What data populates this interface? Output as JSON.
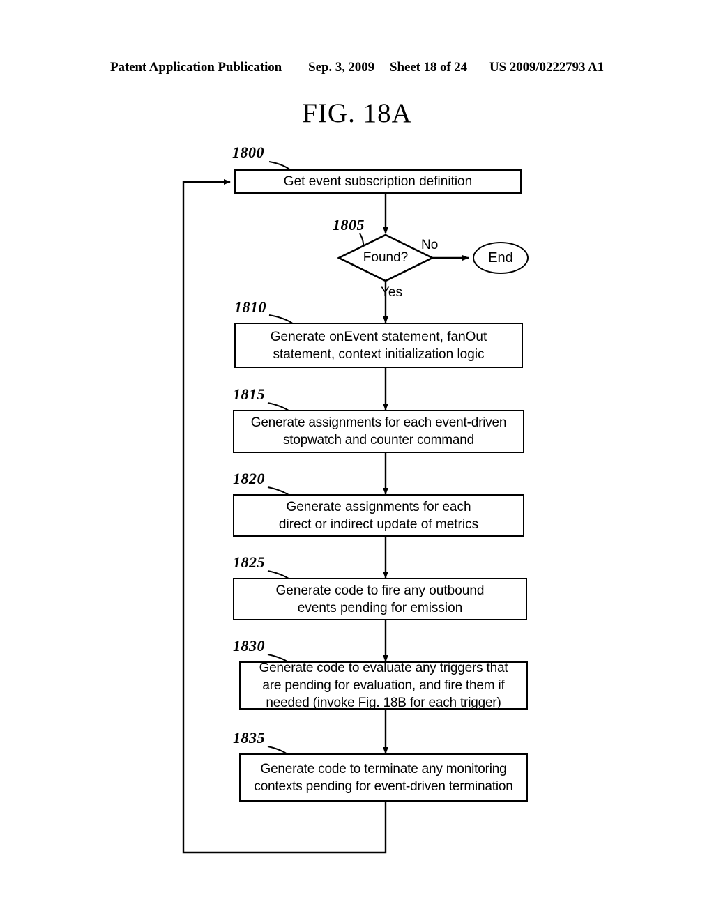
{
  "header": {
    "publication": "Patent Application Publication",
    "date": "Sep. 3, 2009",
    "sheet": "Sheet 18 of 24",
    "number": "US 2009/0222793 A1"
  },
  "figure": {
    "title": "FIG. 18A"
  },
  "nodes": {
    "n1800": {
      "ref": "1800",
      "text": "Get event subscription definition"
    },
    "n1805": {
      "ref": "1805",
      "text": "Found?"
    },
    "end": {
      "text": "End"
    },
    "n1810": {
      "ref": "1810",
      "text": "Generate onEvent statement, fanOut\nstatement, context initialization logic"
    },
    "n1815": {
      "ref": "1815",
      "text": "Generate assignments for each event-driven\nstopwatch and counter command"
    },
    "n1820": {
      "ref": "1820",
      "text": "Generate assignments for each\ndirect or indirect update of metrics"
    },
    "n1825": {
      "ref": "1825",
      "text": "Generate code to fire any outbound\nevents pending for emission"
    },
    "n1830": {
      "ref": "1830",
      "text": "Generate code to evaluate any triggers that\nare pending for evaluation, and fire them if\nneeded (invoke Fig. 18B for each trigger)"
    },
    "n1835": {
      "ref": "1835",
      "text": "Generate code to terminate any monitoring\ncontexts pending for event-driven termination"
    }
  },
  "edges": {
    "no_label": "No",
    "yes_label": "Yes"
  },
  "colors": {
    "stroke": "#000000",
    "background": "#ffffff"
  }
}
